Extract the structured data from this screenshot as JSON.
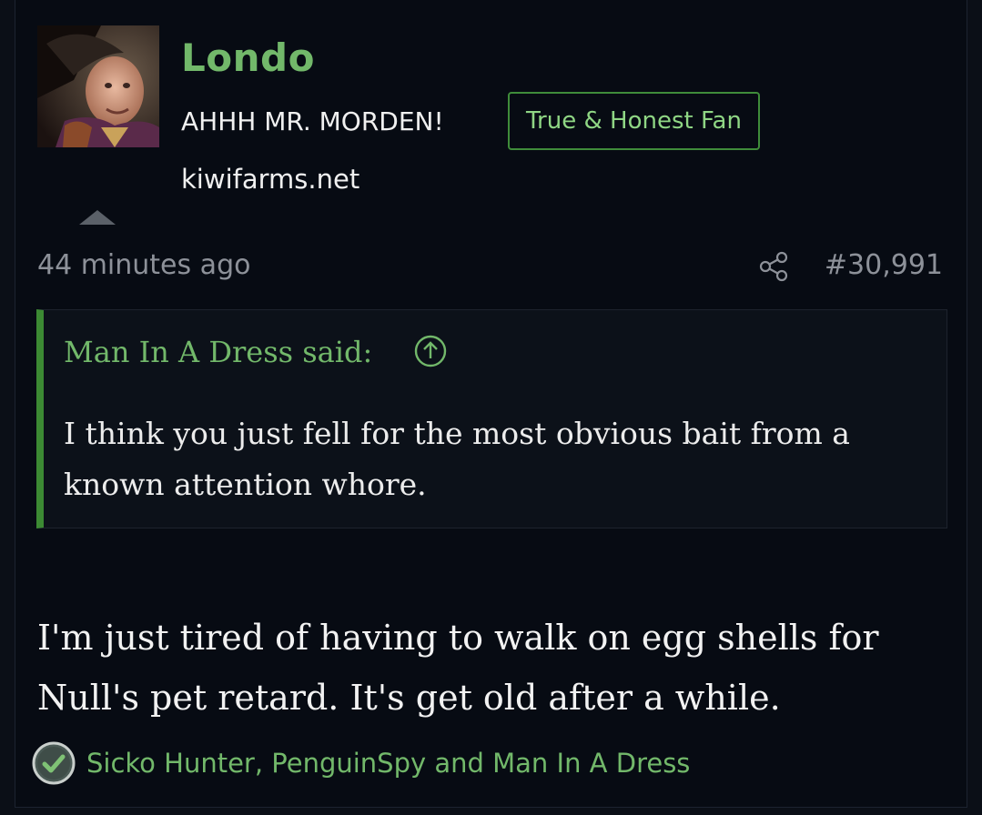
{
  "post": {
    "author": {
      "username": "Londo",
      "user_title": "AHHH MR. MORDEN!",
      "badge": "True & Honest Fan",
      "site": "kiwifarms.net",
      "avatar_icon": "avatar-photo"
    },
    "timestamp": "44 minutes ago",
    "post_number": "#30,991",
    "share_icon": "share-icon",
    "quote": {
      "author_line": "Man In A Dress said:",
      "jump_icon": "arrow-up-circle-icon",
      "text": "I think you just fell for the most obvious bait from a known attention whore."
    },
    "message": "I'm just tired of having to walk on egg shells for Null's pet retard. It's get old after a while.",
    "reactions": {
      "icon": "checkmark-reaction-icon",
      "users": "Sicko Hunter, PenguinSpy and Man In A Dress"
    }
  },
  "colors": {
    "background": "#070b13",
    "accent_green": "#72b86a",
    "badge_border": "#3f8c3a",
    "quote_bar": "#3c8a33",
    "muted_text": "#8d9199"
  }
}
